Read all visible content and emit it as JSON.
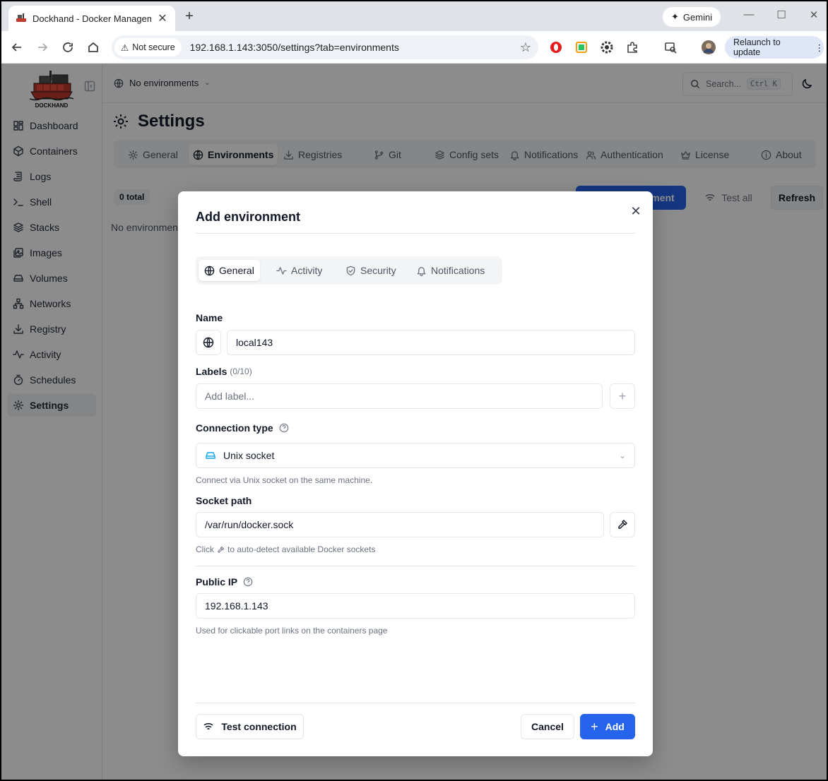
{
  "browser": {
    "tab_title": "Dockhand - Docker Manageme",
    "gemini_label": "Gemini",
    "not_secure": "Not secure",
    "url": "192.168.1.143:3050/settings?tab=environments",
    "relaunch": "Relaunch to update"
  },
  "sidebar": {
    "logo_text": "DOCKHAND",
    "items": [
      {
        "label": "Dashboard",
        "icon": "dashboard-icon"
      },
      {
        "label": "Containers",
        "icon": "box-icon"
      },
      {
        "label": "Logs",
        "icon": "scroll-icon"
      },
      {
        "label": "Shell",
        "icon": "terminal-icon"
      },
      {
        "label": "Stacks",
        "icon": "layers-icon"
      },
      {
        "label": "Images",
        "icon": "images-icon"
      },
      {
        "label": "Volumes",
        "icon": "drive-icon"
      },
      {
        "label": "Networks",
        "icon": "network-icon"
      },
      {
        "label": "Registry",
        "icon": "download-icon"
      },
      {
        "label": "Activity",
        "icon": "activity-icon"
      },
      {
        "label": "Schedules",
        "icon": "timer-icon"
      },
      {
        "label": "Settings",
        "icon": "gear-icon",
        "active": true
      }
    ]
  },
  "topbar": {
    "env_select": "No environments",
    "search_placeholder": "Search...",
    "search_shortcut": "Ctrl K"
  },
  "page": {
    "title": "Settings",
    "tabs": [
      {
        "label": "General"
      },
      {
        "label": "Environments",
        "active": true
      },
      {
        "label": "Registries"
      },
      {
        "label": "Git"
      },
      {
        "label": "Config sets"
      },
      {
        "label": "Notifications"
      },
      {
        "label": "Authentication"
      },
      {
        "label": "License"
      },
      {
        "label": "About"
      }
    ],
    "total": "0 total",
    "add_env_button": "ment",
    "test_all": "Test all",
    "refresh": "Refresh",
    "empty": "No environmen"
  },
  "modal": {
    "title": "Add environment",
    "tabs": [
      {
        "label": "General",
        "active": true
      },
      {
        "label": "Activity"
      },
      {
        "label": "Security"
      },
      {
        "label": "Notifications"
      }
    ],
    "name_label": "Name",
    "name_value": "local143",
    "labels_label": "Labels",
    "labels_count": "(0/10)",
    "labels_placeholder": "Add label...",
    "connection_label": "Connection type",
    "connection_value": "Unix socket",
    "connection_help": "Connect via Unix socket on the same machine.",
    "socket_label": "Socket path",
    "socket_value": "/var/run/docker.sock",
    "socket_help_pre": "Click",
    "socket_help_post": "to auto-detect available Docker sockets",
    "publicip_label": "Public IP",
    "publicip_value": "192.168.1.143",
    "publicip_help": "Used for clickable port links on the containers page",
    "test_connection": "Test connection",
    "cancel": "Cancel",
    "add": "Add"
  },
  "colors": {
    "primary": "#2563eb",
    "socket_icon": "#0ea5e9"
  }
}
